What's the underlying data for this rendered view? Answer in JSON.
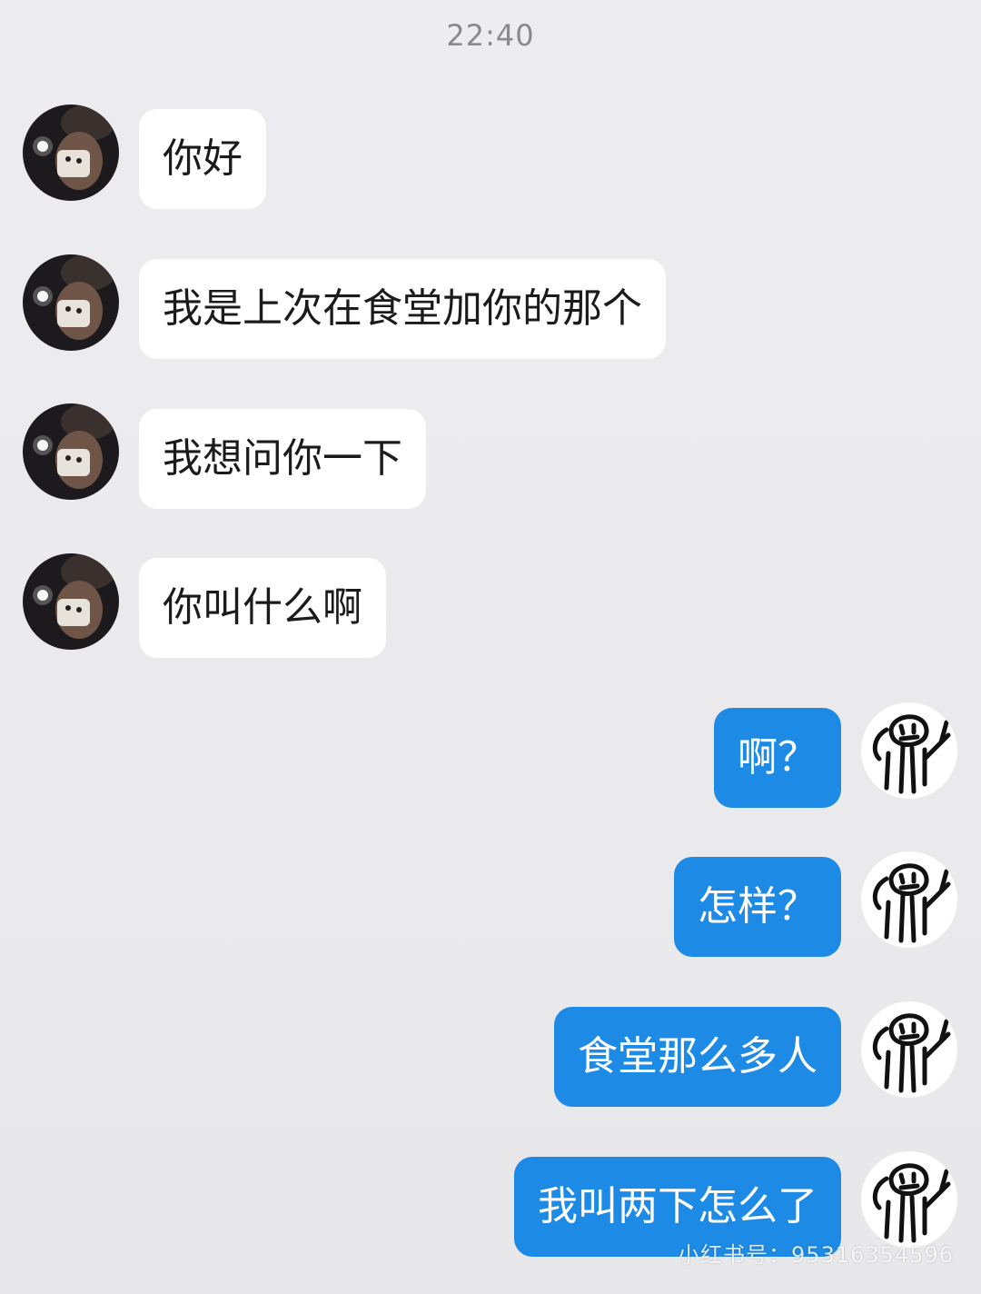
{
  "header": {
    "time": "22:40"
  },
  "contact": {
    "avatar_icon": "contact-photo-avatar"
  },
  "me": {
    "avatar_icon": "stick-figure-avatar"
  },
  "messages_in": [
    {
      "text": "你好"
    },
    {
      "text": "我是上次在食堂加你的那个"
    },
    {
      "text": "我想问你一下"
    },
    {
      "text": "你叫什么啊"
    }
  ],
  "messages_out": [
    {
      "text": "啊？"
    },
    {
      "text": "怎样？"
    },
    {
      "text": "食堂那么多人"
    },
    {
      "text": "我叫两下怎么了"
    }
  ],
  "watermark": "小红书号：95316354596",
  "colors": {
    "background": "#ebebee",
    "incoming_bubble": "#ffffff",
    "outgoing_bubble": "#1d8ae6"
  }
}
